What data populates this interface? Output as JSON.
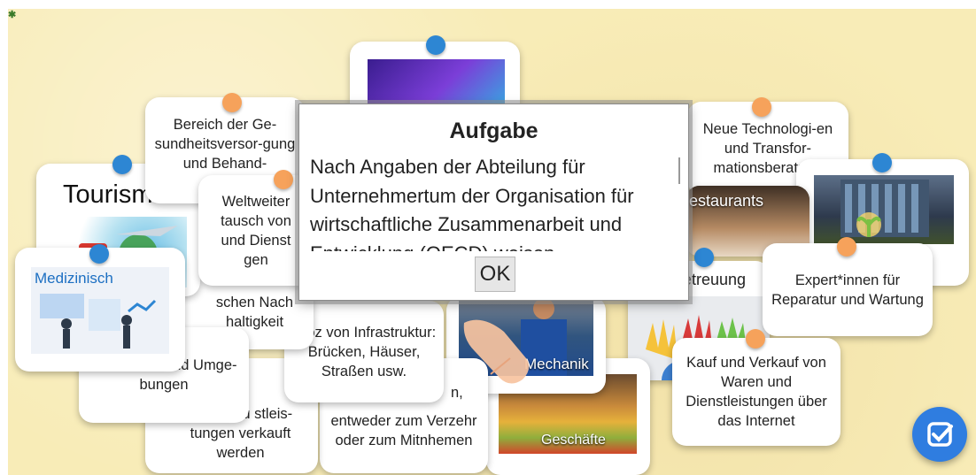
{
  "colors": {
    "board": "#f8ecb7",
    "pin_blue": "#2d86d3",
    "pin_orange": "#f6a25b",
    "check_button": "#2f7de0"
  },
  "cards": {
    "gesundheit": "Bereich der Ge-sundheitsversor-gung und Behand-",
    "neue_technologien": "Neue Technologi-en und Transfor-mationsberatung",
    "weltweiter": "Weltweiter tausch von und Dienst gen",
    "tourismus_label": "Tourism",
    "medizinisch_label": "Medizinisch",
    "nachhaltigkeit": "schen Nach haltigkeit",
    "infrastruktur": "Proz von Infrastruktur: Brücken, Häuser, Straßen usw.",
    "neuer_orte": "neuer Orte und Umge-bungen",
    "orte_produkte": "Orte rodu stleis-tungen verkauft werden",
    "verzehr": "entweder zum Verzehr oder zum Mitnhemen",
    "verzehr_fragment": "n,",
    "mechanik_label": "Mechanik",
    "geschaefte_label": "Geschäfte",
    "restaurants_label": "estaurants",
    "betreuung_label": "etreuung",
    "expert": "Expert*innen für Reparatur und Wartung",
    "kauf": "Kauf und Verkauf von Waren und Dienstleistungen über das Internet"
  },
  "modal": {
    "title": "Aufgabe",
    "text": "Nach Angaben der Abteilung für Unternehmertum der Organisation für wirtschaftliche Zusammenarbeit und Entwicklung (OECD) weisen",
    "ok_label": "OK"
  },
  "icons": {
    "check": "check-square-icon",
    "help": "help-icon"
  }
}
